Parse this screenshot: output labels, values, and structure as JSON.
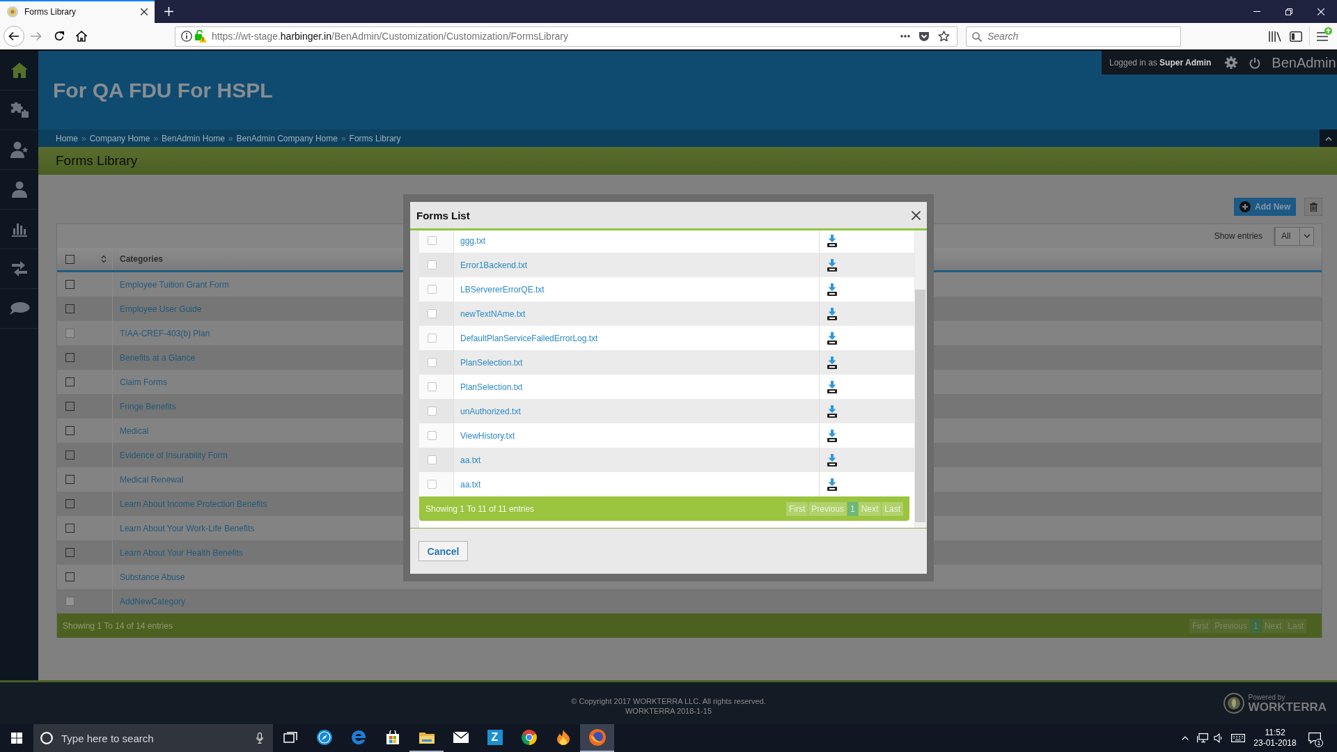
{
  "browser": {
    "tab": {
      "title": "Forms Library",
      "selected": true
    },
    "address_bar": {
      "url_prefix": "https://wt-stage.",
      "url_domain": "harbinger.in",
      "url_path": "/BenAdmin/Customization/Customization/FormsLibrary"
    },
    "search": {
      "placeholder": "Search"
    }
  },
  "sidebar": {
    "items": [
      {
        "kind": "home",
        "selected": true
      },
      {
        "kind": "puzzle",
        "selected": false
      },
      {
        "kind": "user_star",
        "selected": false
      },
      {
        "kind": "user",
        "selected": false
      },
      {
        "kind": "bar_chart",
        "selected": false
      },
      {
        "kind": "swap",
        "selected": false
      },
      {
        "kind": "chat",
        "selected": false
      }
    ]
  },
  "header": {
    "title": "For QA FDU For HSPL",
    "user_text": "Logged in as **Super Admin**",
    "app_name": "BenAdmin",
    "breadcrumb_separator": "»",
    "breadcrumb": [
      "Home",
      "Company Home",
      "BenAdmin Home",
      "BenAdmin Company Home",
      "Forms Library"
    ]
  },
  "page_title": "Forms Library",
  "actions": {
    "add_button": "Add New"
  },
  "table": {
    "show_entries_label": "Show entries",
    "show_entries_value": "All",
    "header_checked": false,
    "columns": [
      "Categories"
    ],
    "rows": [
      {
        "category": "Employee Tuition Grant Form",
        "checked": false,
        "disabled": false
      },
      {
        "category": "Employee User Guide",
        "checked": false,
        "disabled": false
      },
      {
        "category": "TIAA-CREF-403(b) Plan",
        "checked": false,
        "disabled": true
      },
      {
        "category": "Benefits at a Glance",
        "checked": false,
        "disabled": false
      },
      {
        "category": "Claim Forms",
        "checked": false,
        "disabled": false
      },
      {
        "category": "Fringe Benefits",
        "checked": false,
        "disabled": false
      },
      {
        "category": "Medical",
        "checked": false,
        "disabled": false
      },
      {
        "category": "Evidence of Insurability Form",
        "checked": false,
        "disabled": false
      },
      {
        "category": "Medical Renewal",
        "checked": false,
        "disabled": false
      },
      {
        "category": "Learn About Income Protection Benefits",
        "checked": false,
        "disabled": false
      },
      {
        "category": "Learn About Your Work-Life Benefits",
        "checked": false,
        "disabled": false
      },
      {
        "category": "Learn About Your Health Benefits",
        "checked": false,
        "disabled": false
      },
      {
        "category": "Substance Abuse",
        "checked": false,
        "disabled": false
      },
      {
        "category": "AddNewCategory",
        "checked": false,
        "disabled": true
      }
    ],
    "footer": "Showing 1 To 14 of 14 entries",
    "pagination": [
      {
        "label": "First",
        "selected": false
      },
      {
        "label": "Previous",
        "selected": false
      },
      {
        "label": "1",
        "selected": true
      },
      {
        "label": "Next",
        "selected": false
      },
      {
        "label": "Last",
        "selected": false
      }
    ]
  },
  "modal": {
    "title": "Forms List",
    "rows": [
      {
        "file": "ggg.txt",
        "checked": false
      },
      {
        "file": "Error1Backend.txt",
        "checked": false
      },
      {
        "file": "LBServererErrorQE.txt",
        "checked": false
      },
      {
        "file": "newTextNAme.txt",
        "checked": false
      },
      {
        "file": "DefaultPlanServiceFailedErrorLog.txt",
        "checked": false
      },
      {
        "file": "PlanSelection.txt",
        "checked": false
      },
      {
        "file": "PlanSelection.txt",
        "checked": false
      },
      {
        "file": "unAuthorized.txt",
        "checked": false
      },
      {
        "file": "ViewHistory.txt",
        "checked": false
      },
      {
        "file": "aa.txt",
        "checked": false
      },
      {
        "file": "aa.txt",
        "checked": false
      }
    ],
    "footer": "Showing 1 To 11 of 11 entries",
    "pagination": [
      {
        "label": "First",
        "selected": false
      },
      {
        "label": "Previous",
        "selected": false
      },
      {
        "label": "1",
        "selected": true
      },
      {
        "label": "Next",
        "selected": false
      },
      {
        "label": "Last",
        "selected": false
      }
    ],
    "cancel_button": "Cancel"
  },
  "footer": {
    "copyright": "© Copyright 2017 WORKTERRA LLC. All rights reserved.",
    "version": "WORKTERRA 2018-1-15",
    "powered_by": "Powered by",
    "brand": "WORKTERRA"
  },
  "taskbar": {
    "search_placeholder": "Type here to search",
    "apps": [
      {
        "kind": "task_view",
        "running": false,
        "selected": false
      },
      {
        "kind": "compass",
        "running": false,
        "selected": false
      },
      {
        "kind": "edge",
        "running": false,
        "selected": false
      },
      {
        "kind": "store",
        "running": false,
        "selected": false
      },
      {
        "kind": "explorer",
        "running": true,
        "selected": false
      },
      {
        "kind": "mail",
        "running": false,
        "selected": false
      },
      {
        "kind": "letter_tile",
        "label": "Z",
        "running": false,
        "selected": false
      },
      {
        "kind": "chrome",
        "running": false,
        "selected": false
      },
      {
        "kind": "flame",
        "running": false,
        "selected": false
      },
      {
        "kind": "firefox",
        "running": true,
        "selected": true
      }
    ],
    "time": "11:52",
    "date": "23-01-2018",
    "notification_count": "1"
  }
}
